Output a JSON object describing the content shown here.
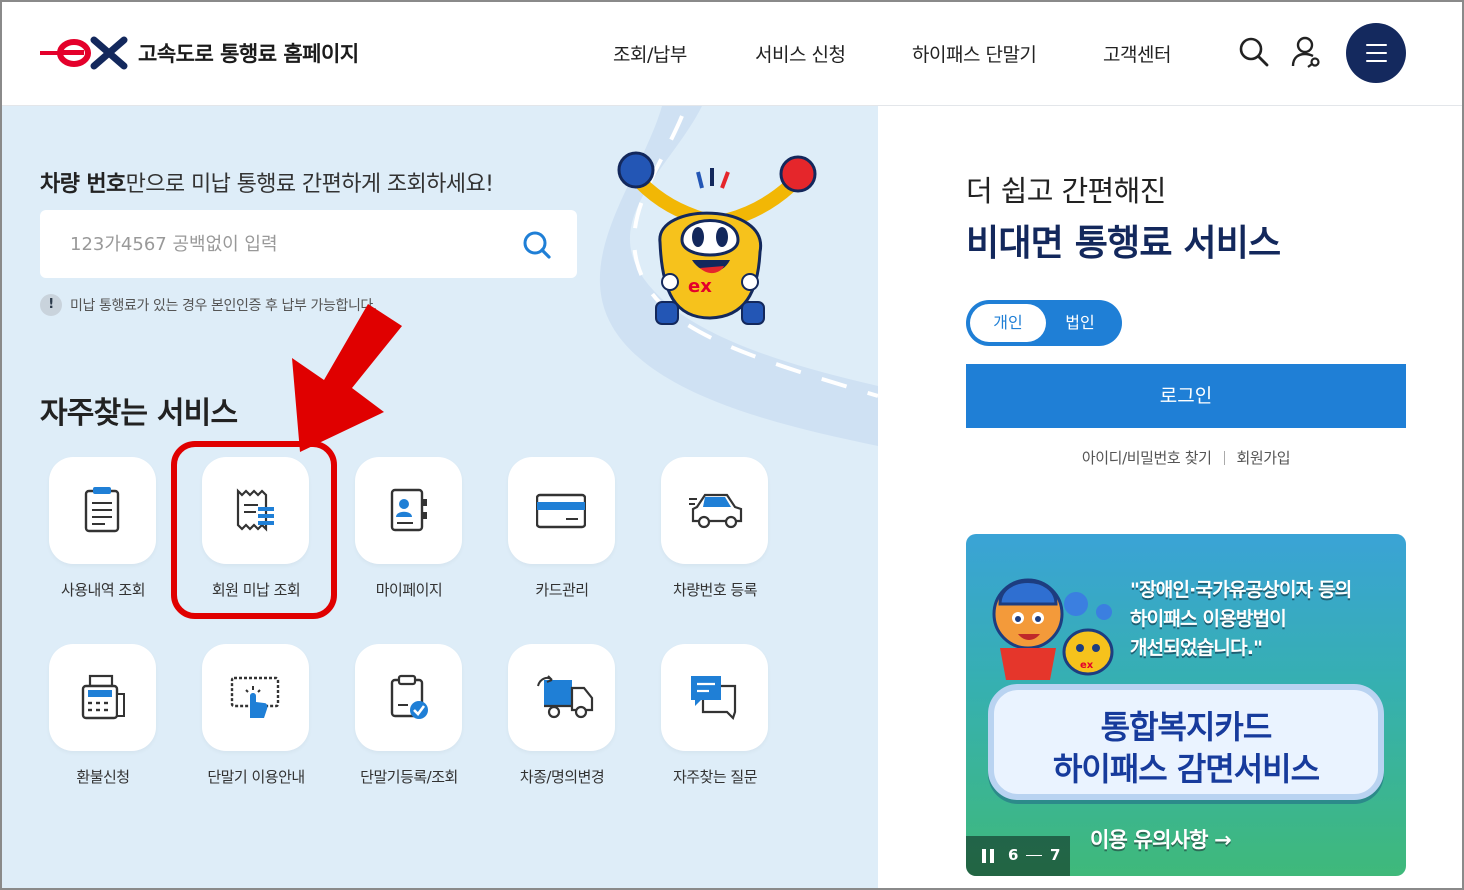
{
  "header": {
    "logo_text": "ex",
    "site_title": "고속도로 통행료 홈페이지",
    "nav": [
      "조회/납부",
      "서비스 신청",
      "하이패스 단말기",
      "고객센터"
    ]
  },
  "search": {
    "title_bold": "차량 번호",
    "title_rest": "만으로 미납 통행료 간편하게 조회하세요!",
    "placeholder": "123가4567 공백없이 입력",
    "notice": "미납 통행료가 있는 경우 본인인증 후 납부 가능합니다."
  },
  "favorites": {
    "title": "자주찾는 서비스",
    "items": [
      {
        "label": "사용내역 조회",
        "icon": "document-list-icon"
      },
      {
        "label": "회원 미납 조회",
        "icon": "receipt-icon"
      },
      {
        "label": "마이페이지",
        "icon": "contact-book-icon"
      },
      {
        "label": "카드관리",
        "icon": "credit-card-icon"
      },
      {
        "label": "차량번호 등록",
        "icon": "car-icon"
      },
      {
        "label": "환불신청",
        "icon": "cash-register-icon"
      },
      {
        "label": "단말기 이용안내",
        "icon": "touch-screen-icon"
      },
      {
        "label": "단말기등록/조회",
        "icon": "clipboard-check-icon"
      },
      {
        "label": "차종/명의변경",
        "icon": "truck-icon"
      },
      {
        "label": "자주찾는 질문",
        "icon": "chat-bubble-icon"
      }
    ]
  },
  "login": {
    "subtitle": "더 쉽고 간편해진",
    "title": "비대면 통행료 서비스",
    "toggle": [
      "개인",
      "법인"
    ],
    "button": "로그인",
    "find_link": "아이디/비밀번호 찾기",
    "join_link": "회원가입"
  },
  "banner": {
    "quote_line1": "\"장애인·국가유공상이자 등의",
    "quote_line2": "하이패스 이용방법이",
    "quote_line3": "개선되었습니다.\"",
    "main_line1": "통합복지카드",
    "main_line2": "하이패스 감면서비스",
    "caution": "이용 유의사항 →",
    "page_current": "6",
    "page_total": "7"
  },
  "colors": {
    "brand_navy": "#13285c",
    "brand_blue": "#1f7fd6",
    "brand_red": "#e4002b",
    "left_bg": "#deedf8",
    "highlight_red": "#e00000"
  }
}
